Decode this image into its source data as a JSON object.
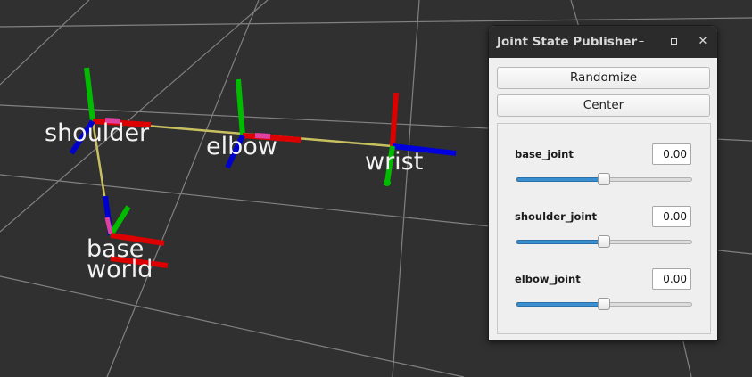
{
  "scene": {
    "background_color": "#303030",
    "frames": [
      {
        "label": "shoulder"
      },
      {
        "label": "elbow"
      },
      {
        "label": "wrist"
      },
      {
        "label": "base"
      },
      {
        "label": "world"
      }
    ],
    "axis_colors": {
      "x": "#e00000",
      "y": "#00c000",
      "z": "#0000e0"
    },
    "link_color": "#c8c060"
  },
  "window": {
    "title": "Joint State Publisher",
    "minimize_glyph": "–",
    "close_glyph": "✕",
    "randomize_label": "Randomize",
    "center_label": "Center",
    "joints": [
      {
        "name": "base_joint",
        "value": "0.00",
        "slider_fraction": 0.5
      },
      {
        "name": "shoulder_joint",
        "value": "0.00",
        "slider_fraction": 0.5
      },
      {
        "name": "elbow_joint",
        "value": "0.00",
        "slider_fraction": 0.5
      }
    ]
  }
}
